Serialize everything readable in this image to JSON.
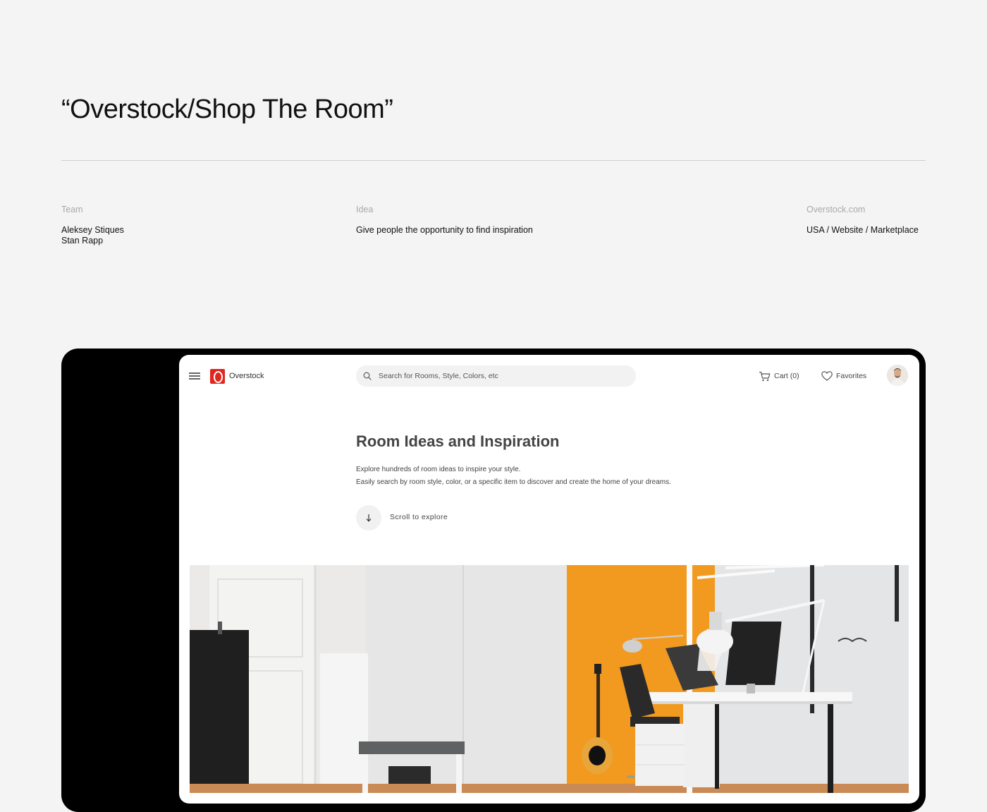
{
  "project": {
    "title": "“Overstock/Shop The Room”"
  },
  "meta": {
    "team": {
      "label": "Team",
      "members": [
        "Aleksey Stiques",
        "Stan Rapp"
      ]
    },
    "idea": {
      "label": "Idea",
      "value": "Give people the opportunity to find inspiration"
    },
    "site": {
      "label": "Overstock.com",
      "value": "USA / Website / Marketplace"
    }
  },
  "app": {
    "brand": "Overstock",
    "brand_color": "#e0261d",
    "search": {
      "placeholder": "Search for Rooms, Style, Colors, etc",
      "icon": "search-icon"
    },
    "cart": {
      "label": "Cart (0)",
      "icon": "cart-icon"
    },
    "favorites": {
      "label": "Favorites",
      "icon": "heart-icon"
    },
    "hero": {
      "title": "Room Ideas and Inspiration",
      "lines": [
        "Explore hundreds of room ideas to inspire your style.",
        "Easily search by room style, color, or a specific item to discover and create the home of your dreams."
      ],
      "scroll_label": "Scroll to explore",
      "scroll_icon": "arrow-down-icon"
    },
    "photo_accent_color": "#f29a1f"
  }
}
